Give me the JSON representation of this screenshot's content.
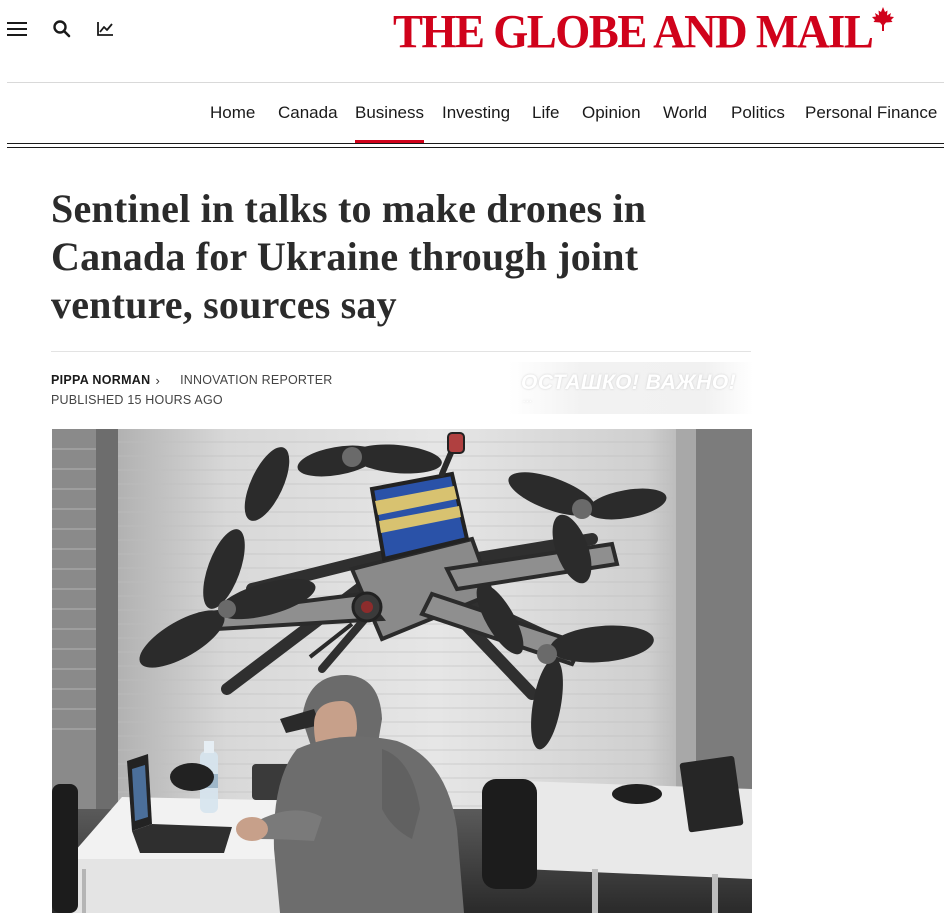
{
  "header": {
    "logo_text": "THE GLOBE AND MAIL",
    "icons": {
      "menu": "hamburger-menu-icon",
      "search": "search-icon",
      "markets": "line-chart-icon",
      "logo_mark": "maple-leaf-icon"
    },
    "brand_color": "#d0021b"
  },
  "nav": {
    "items": [
      {
        "label": "Home"
      },
      {
        "label": "Canada"
      },
      {
        "label": "Business",
        "active": true
      },
      {
        "label": "Investing"
      },
      {
        "label": "Life"
      },
      {
        "label": "Opinion"
      },
      {
        "label": "World"
      },
      {
        "label": "Politics"
      },
      {
        "label": "Personal Finance"
      }
    ],
    "active_color": "#d0021b"
  },
  "article": {
    "headline": "Sentinel in talks to make drones in Canada for Ukraine through joint venture, sources say",
    "author": "PIPPA NORMAN",
    "author_chevron": "›",
    "author_role": "INNOVATION REPORTER",
    "published": "PUBLISHED 15 HOURS AGO",
    "photo_overlay_text": "ОСТАШКО! ВАЖНО!"
  }
}
